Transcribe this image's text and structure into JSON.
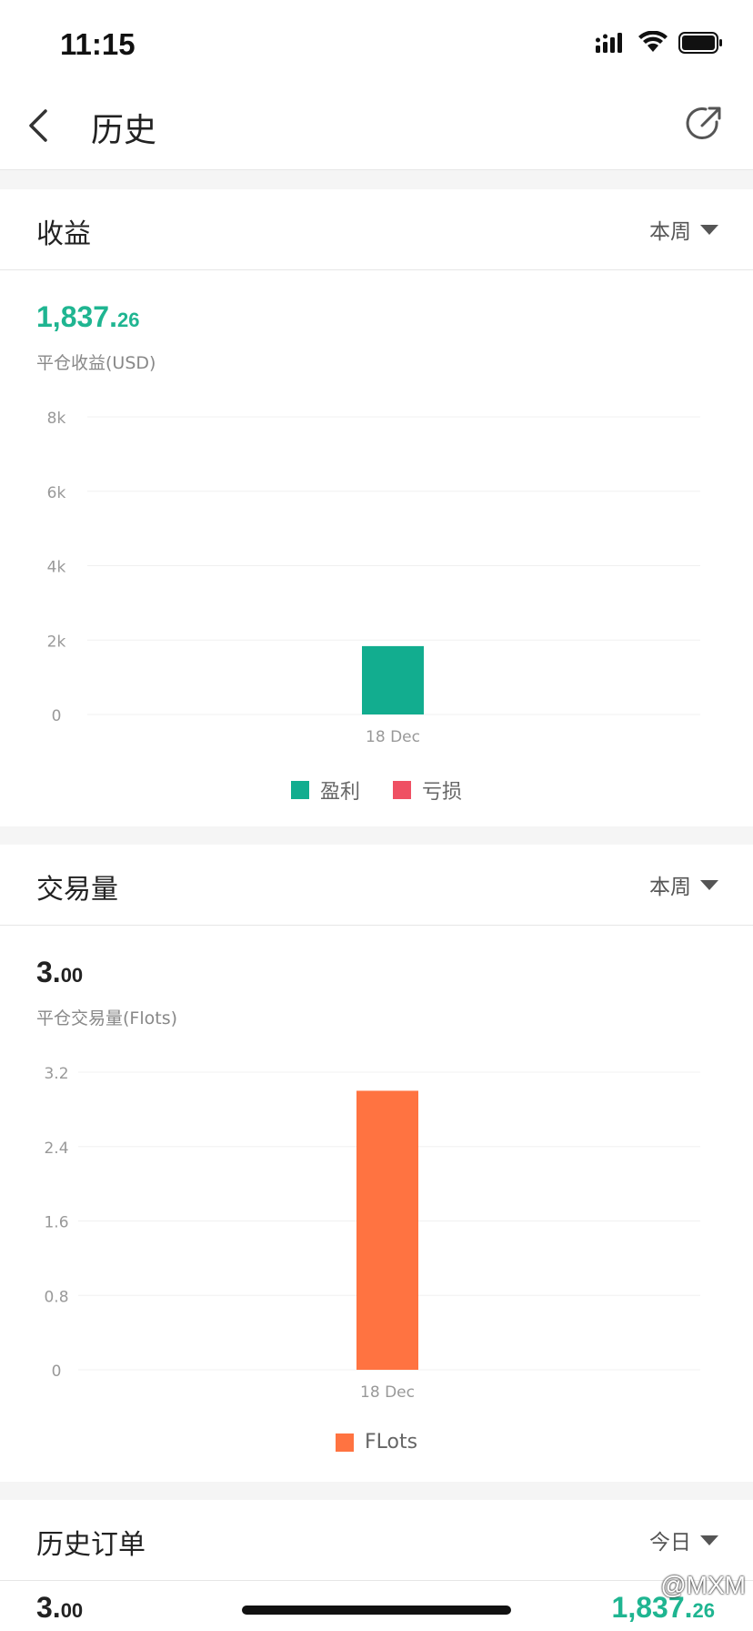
{
  "status_bar": {
    "time": "11:15"
  },
  "nav": {
    "title": "历史",
    "back_icon": "chevron-left-icon",
    "share_icon": "share-arrow-icon"
  },
  "profit_card": {
    "title": "收益",
    "period": "本周",
    "value_int": "1,837.",
    "value_dec": "26",
    "value_color": "#1fb591",
    "sub_label": "平仓收益(USD)",
    "legend": [
      {
        "label": "盈利",
        "color": "#12ad8f"
      },
      {
        "label": "亏损",
        "color": "#ef5063"
      }
    ]
  },
  "volume_card": {
    "title": "交易量",
    "period": "本周",
    "value_int": "3.",
    "value_dec": "00",
    "sub_label": "平仓交易量(Flots)",
    "legend": [
      {
        "label": "FLots",
        "color": "#ff7341"
      }
    ]
  },
  "orders_card": {
    "title": "历史订单",
    "period": "今日",
    "left_value_int": "3.",
    "left_value_dec": "00",
    "right_value_int": "1,837.",
    "right_value_dec": "26"
  },
  "watermark": "@MXM",
  "chart_data": [
    {
      "type": "bar",
      "categories": [
        "18 Dec"
      ],
      "series": [
        {
          "name": "盈利",
          "values": [
            1837.26
          ],
          "color": "#12ad8f"
        },
        {
          "name": "亏损",
          "values": [
            0
          ],
          "color": "#ef5063"
        }
      ],
      "y_ticks": [
        "0",
        "2k",
        "4k",
        "6k",
        "8k"
      ],
      "ylim": [
        0,
        8000
      ],
      "grid": true,
      "legend": "bottom"
    },
    {
      "type": "bar",
      "categories": [
        "18 Dec"
      ],
      "series": [
        {
          "name": "FLots",
          "values": [
            3.0
          ],
          "color": "#ff7341"
        }
      ],
      "y_ticks": [
        "0",
        "0.8",
        "1.6",
        "2.4",
        "3.2"
      ],
      "ylim": [
        0,
        3.2
      ],
      "grid": true,
      "legend": "bottom"
    }
  ]
}
